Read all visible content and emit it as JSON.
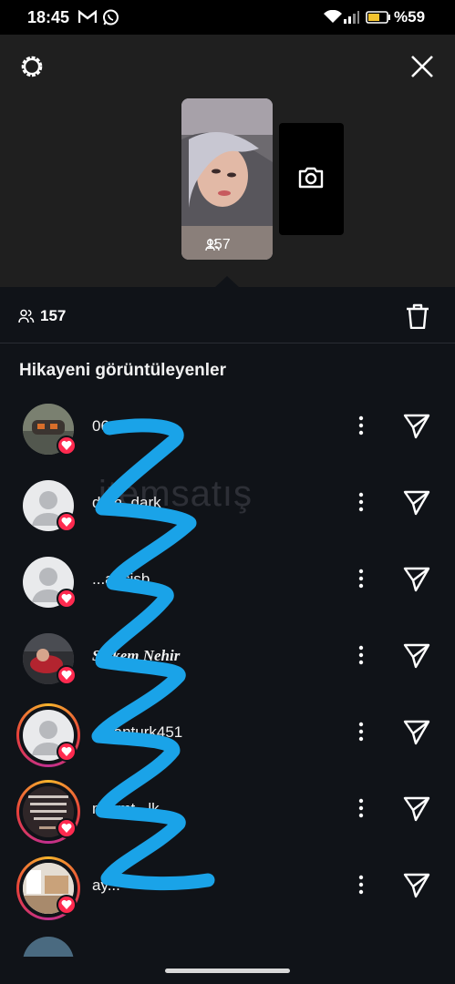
{
  "status_bar": {
    "time": "18:45",
    "battery_percent": "%59",
    "icons": [
      "gmail-icon",
      "whatsapp-icon",
      "wifi-icon",
      "signal-icon",
      "battery-icon"
    ]
  },
  "header": {
    "settings_icon": "gear-icon",
    "close_icon": "close-icon",
    "story_viewer_count": "157",
    "add_story_icon": "camera-icon"
  },
  "summary": {
    "viewer_count": "157",
    "delete_icon": "trash-icon"
  },
  "section_title": "Hikayeni görüntüleyenler",
  "viewers": [
    {
      "username": "06...kan25",
      "liked": true,
      "story_ring": false
    },
    {
      "username": "d...n_dark",
      "liked": true,
      "story_ring": false
    },
    {
      "username": "...absisb",
      "liked": true,
      "story_ring": false
    },
    {
      "username": "S...kem Nehir",
      "liked": true,
      "story_ring": false
    },
    {
      "username": "...ganturk451",
      "liked": true,
      "story_ring": true
    },
    {
      "username": "m...mt...lk",
      "liked": true,
      "story_ring": true
    },
    {
      "username": "ay...",
      "liked": true,
      "story_ring": true
    }
  ],
  "watermark": "itemsatış",
  "colors": {
    "background": "#101318",
    "header": "#1f1f1f",
    "heart": "#ff2a4f",
    "scribble": "#1aa3e8"
  }
}
